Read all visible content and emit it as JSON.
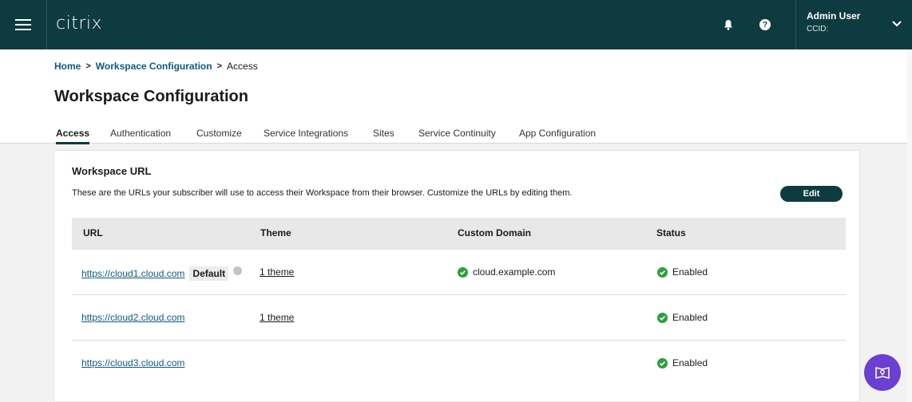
{
  "topbar": {
    "logo": "citrix",
    "icons": [
      "menu-icon",
      "bell-icon",
      "help-icon",
      "chevron-down-icon"
    ],
    "user_name": "Admin User",
    "user_ccid": "CCID:"
  },
  "breadcrumb": {
    "home": "Home",
    "section": "Workspace Configuration",
    "current": "Access",
    "separator": ">"
  },
  "page": {
    "title": "Workspace Configuration"
  },
  "tabs": [
    {
      "label": "Access",
      "active": true
    },
    {
      "label": "Authentication"
    },
    {
      "label": "Customize"
    },
    {
      "label": "Service Integrations"
    },
    {
      "label": "Sites"
    },
    {
      "label": "Service Continuity"
    },
    {
      "label": "App Configuration"
    }
  ],
  "workspace_url": {
    "title": "Workspace URL",
    "description": "These are the URLs your subscriber will use to access their Workspace from their browser. Customize the URLs by editing them.",
    "edit_label": "Edit",
    "columns": [
      "URL",
      "Theme",
      "Custom Domain",
      "Status"
    ],
    "rows": [
      {
        "url": "https://cloud1.cloud.com",
        "badge": "Default",
        "theme": "1 theme",
        "custom_domain": "cloud.example.com",
        "status": "Enabled"
      },
      {
        "url": "https://cloud2.cloud.com",
        "badge": "",
        "theme": "1 theme",
        "custom_domain": "",
        "status": "Enabled"
      },
      {
        "url": "https://cloud3.cloud.com",
        "badge": "",
        "theme": "",
        "custom_domain": "",
        "status": "Enabled"
      }
    ]
  },
  "colors": {
    "topbar": "#0e3b3f",
    "link": "#0e5a80",
    "success": "#2e9e3e",
    "fab": "#6b3fd1"
  }
}
